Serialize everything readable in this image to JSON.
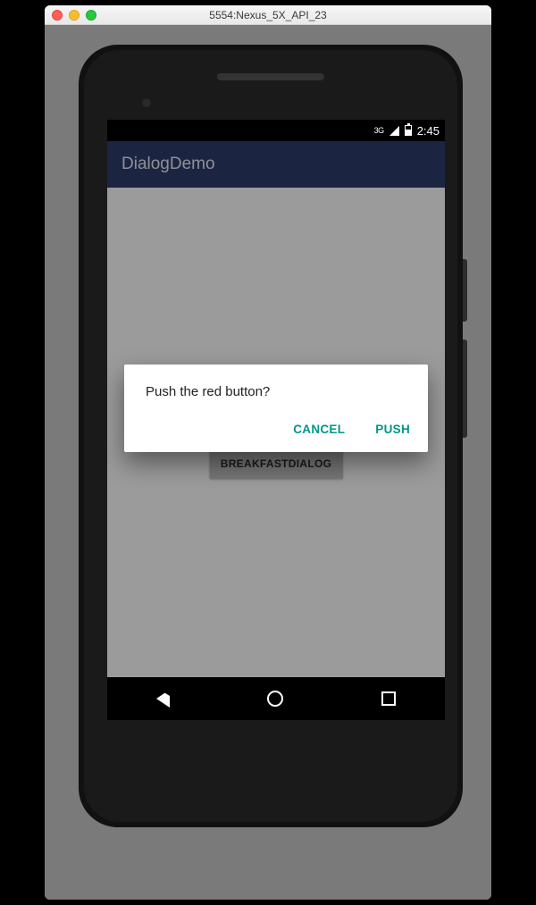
{
  "window": {
    "title": "5554:Nexus_5X_API_23"
  },
  "statusbar": {
    "network": "3G",
    "time": "2:45"
  },
  "appbar": {
    "title": "DialogDemo"
  },
  "background_button": {
    "label": "BREAKFASTDIALOG"
  },
  "dialog": {
    "message": "Push the red button?",
    "cancel": "CANCEL",
    "confirm": "PUSH"
  },
  "colors": {
    "appbar_bg": "#2d3a6a",
    "dialog_accent": "#009688"
  }
}
